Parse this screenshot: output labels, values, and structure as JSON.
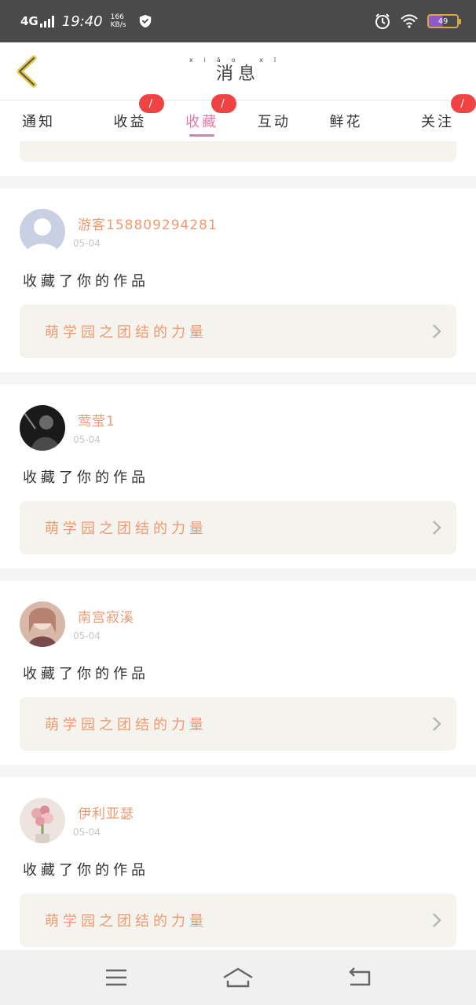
{
  "status_bar": {
    "network": "4G",
    "time": "19:40",
    "speed_value": "166",
    "speed_unit": "KB/s",
    "battery": "49"
  },
  "header": {
    "title": "消息",
    "title_pinyin": "xiāo xī"
  },
  "tabs": [
    {
      "label": "通知",
      "badge": ""
    },
    {
      "label": "收益",
      "badge": "/"
    },
    {
      "label": "收藏",
      "badge": "/"
    },
    {
      "label": "互动",
      "badge": ""
    },
    {
      "label": "鲜花",
      "badge": ""
    },
    {
      "label": "关注",
      "badge": "/"
    }
  ],
  "active_tab": "收藏",
  "cards": [
    {
      "user": "游客158809294281",
      "date": "05-04",
      "action": "收藏了你的作品",
      "work": "萌学园之团结的力量",
      "avatar": "default-avatar"
    },
    {
      "user": "莺莹1",
      "date": "05-04",
      "action": "收藏了你的作品",
      "work": "萌学园之团结的力量",
      "avatar": "dark-photo-avatar"
    },
    {
      "user": "南宫寂溪",
      "date": "05-04",
      "action": "收藏了你的作品",
      "work": "萌学园之团结的力量",
      "avatar": "anime-girl-avatar"
    },
    {
      "user": "伊利亚瑟",
      "date": "05-04",
      "action": "收藏了你的作品",
      "work": "萌学园之团结的力量",
      "avatar": "flower-avatar"
    }
  ],
  "colors": {
    "accent": "#e07aa9",
    "name": "#ef9a70",
    "badge": "#f04444",
    "link_bg": "#f4f3ed"
  },
  "icons": [
    "back-chevron-icon",
    "chevron-right-icon",
    "menu-icon",
    "home-icon",
    "back-icon",
    "alarm-icon",
    "wifi-icon",
    "vpn-shield-icon"
  ]
}
